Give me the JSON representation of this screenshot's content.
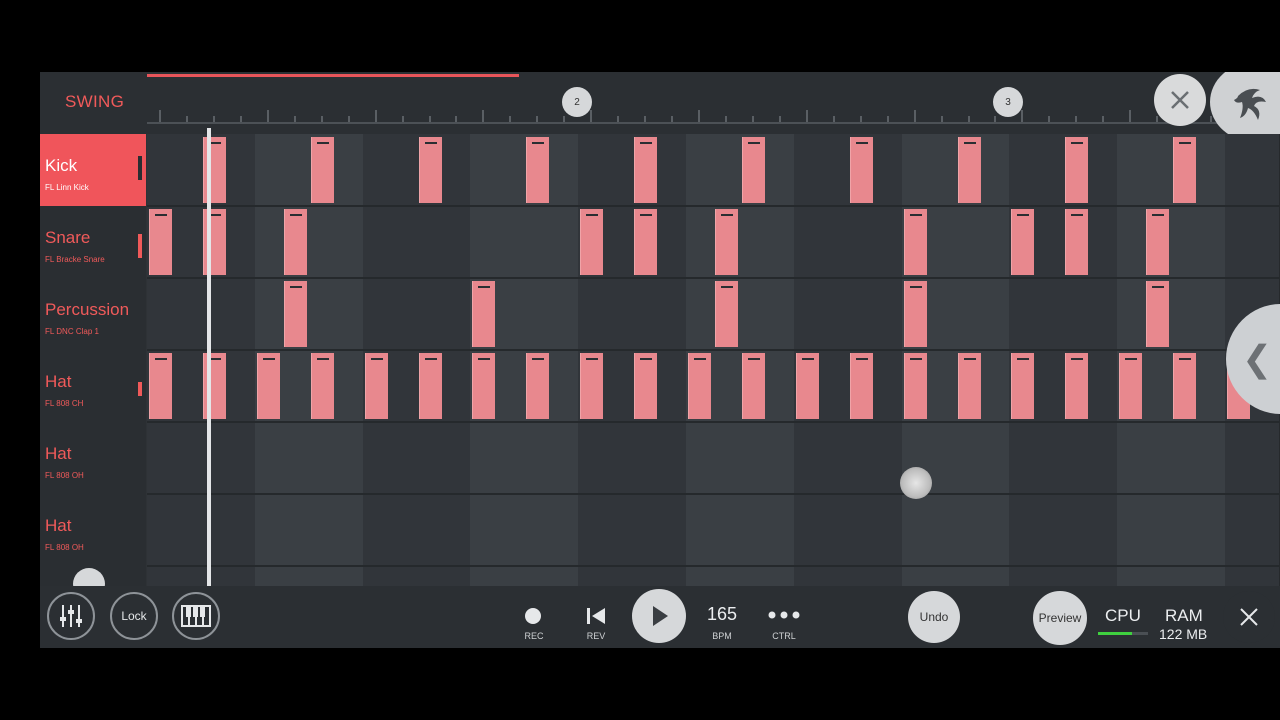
{
  "header": {
    "swing_label": "SWING",
    "bar_markers": [
      "2",
      "3"
    ]
  },
  "channels": [
    {
      "name": "Kick",
      "sample": "FL Linn Kick",
      "active": true
    },
    {
      "name": "Snare",
      "sample": "FL Bracke Snare",
      "active": false
    },
    {
      "name": "Percussion",
      "sample": "FL DNC Clap 1",
      "active": false
    },
    {
      "name": "Hat",
      "sample": "FL 808 CH",
      "active": false
    },
    {
      "name": "Hat",
      "sample": "FL 808 OH",
      "active": false
    },
    {
      "name": "Hat",
      "sample": "FL 808 OH",
      "active": false
    }
  ],
  "pattern": {
    "steps": 42,
    "rows": [
      [
        2,
        6,
        10,
        14,
        18,
        22,
        26,
        30,
        34,
        38
      ],
      [
        0,
        2,
        5,
        16,
        18,
        21,
        28,
        32,
        34,
        37
      ],
      [
        5,
        12,
        21,
        28,
        37
      ],
      [
        0,
        2,
        4,
        6,
        8,
        10,
        12,
        14,
        16,
        18,
        20,
        22,
        24,
        26,
        28,
        30,
        32,
        34,
        36,
        38,
        40
      ],
      [],
      []
    ]
  },
  "toolbar": {
    "lock_label": "Lock",
    "rec_label": "REC",
    "rev_label": "REV",
    "bpm_value": "165",
    "bpm_label": "BPM",
    "ctrl_label": "CTRL",
    "undo_label": "Undo",
    "preview_label": "Preview",
    "cpu_label": "CPU",
    "ram_label": "RAM",
    "ram_value": "122 MB"
  },
  "status": {
    "cpu_load": 0.68
  },
  "colors": {
    "accent": "#f0555b",
    "note": "#e8888e",
    "background": "#2e3236"
  },
  "icons": [
    "mixer-icon",
    "piano-icon",
    "record-icon",
    "rewind-icon",
    "play-icon",
    "more-icon",
    "close-icon",
    "fl-fruit-logo-icon",
    "chevron-left-icon"
  ]
}
